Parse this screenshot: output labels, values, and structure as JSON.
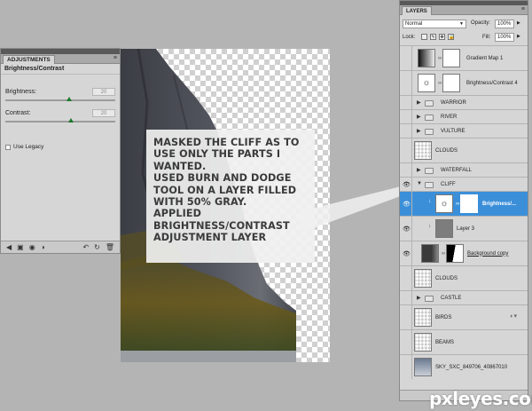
{
  "adjustments": {
    "tab": "ADJUSTMENTS",
    "title": "Brightness/Contrast",
    "brightness_label": "Brightness:",
    "brightness_value": "20",
    "contrast_label": "Contrast:",
    "contrast_value": "20",
    "use_legacy": "Use Legacy",
    "brightness_slider_fraction": 0.58,
    "contrast_slider_fraction": 0.6
  },
  "note": {
    "lines": [
      "MASKED THE CLIFF AS TO",
      "USE ONLY THE PARTS I",
      "WANTED.",
      "USED BURN AND DODGE",
      "TOOL ON A LAYER FILLED",
      "WITH 50% GRAY.",
      "APPLIED",
      "BRIGHTNESS/CONTRAST",
      "ADJUSTMENT LAYER"
    ]
  },
  "layers_panel": {
    "tab": "LAYERS",
    "blend_mode": "Normal",
    "opacity_label": "Opacity:",
    "opacity_value": "100%",
    "lock_label": "Lock:",
    "fill_label": "Fill:",
    "fill_value": "100%",
    "layers": [
      {
        "name": "Gradient Map 1",
        "kind": "adjustment"
      },
      {
        "name": "Brightness/Contrast 4",
        "kind": "adjustment"
      },
      {
        "name": "WARRIOR",
        "kind": "group"
      },
      {
        "name": "RIVER",
        "kind": "group"
      },
      {
        "name": "VULTURE",
        "kind": "group"
      },
      {
        "name": "CLOUDS",
        "kind": "layer"
      },
      {
        "name": "WATERFALL",
        "kind": "group"
      },
      {
        "name": "CLIFF",
        "kind": "group-open"
      },
      {
        "name": "Brightness/...",
        "kind": "adjustment-selected"
      },
      {
        "name": "Layer 3",
        "kind": "gray"
      },
      {
        "name": "Background copy",
        "kind": "masked"
      },
      {
        "name": "CLOUDS",
        "kind": "layer"
      },
      {
        "name": "CASTLE",
        "kind": "group"
      },
      {
        "name": "BIRDS",
        "kind": "layer"
      },
      {
        "name": "BEAMS",
        "kind": "layer"
      },
      {
        "name": "SKY_SXC_849706_40867010",
        "kind": "photo"
      }
    ]
  },
  "watermark": "pxleyes.com",
  "colors": {
    "selection": "#3b8fd9",
    "panel": "#d6d6d6",
    "workspace": "#b4b4b4"
  }
}
